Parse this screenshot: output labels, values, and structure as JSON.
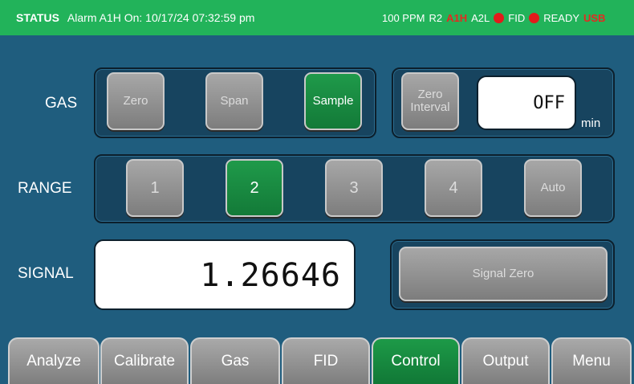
{
  "status": {
    "label": "STATUS",
    "alarm": "Alarm A1H On: 10/17/24 07:32:59 pm",
    "ppm": "100 PPM",
    "range": "R2",
    "a1h": "A1H",
    "a2l": "A2L",
    "fid": "FID",
    "ready": "READY",
    "usb": "USB"
  },
  "gas": {
    "label": "GAS",
    "buttons": [
      "Zero",
      "Span",
      "Sample"
    ],
    "active": "Sample",
    "zero_interval_label": "Zero Interval",
    "zero_interval_value": "OFF",
    "zero_interval_unit": "min"
  },
  "range": {
    "label": "RANGE",
    "buttons": [
      "1",
      "2",
      "3",
      "4",
      "Auto"
    ],
    "active": "2"
  },
  "signal": {
    "label": "SIGNAL",
    "value": "1.26646",
    "zero_button": "Signal Zero"
  },
  "tabs": [
    "Analyze",
    "Calibrate",
    "Gas",
    "FID",
    "Control",
    "Output",
    "Menu"
  ],
  "active_tab": "Control",
  "colors": {
    "background": "#1f5d7e",
    "status_bar": "#22b35a",
    "active_button": "#1a8a42",
    "alarm_red": "#e21b1b"
  }
}
